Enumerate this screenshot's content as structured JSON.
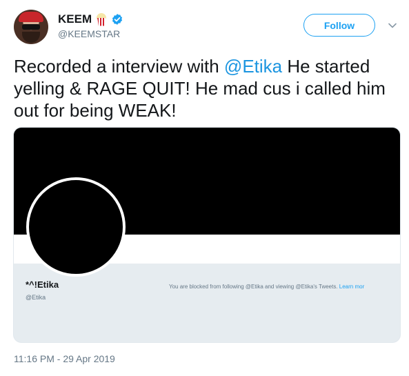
{
  "user": {
    "display_name": "KEEM",
    "handle": "@KEEMSTAR",
    "emoji_icon": "popcorn-icon",
    "verified": true
  },
  "actions": {
    "follow_label": "Follow",
    "menu_icon": "chevron-down-icon"
  },
  "tweet": {
    "text_before": "Recorded a interview with ",
    "mention": "@Etika",
    "text_after": " He started yelling & RAGE QUIT! He mad cus i called him out for being WEAK!",
    "timestamp": "11:16 PM - 29 Apr 2019"
  },
  "card": {
    "profile_name": "*^!Etika",
    "profile_handle": "@Etika",
    "blocked_message": "You are blocked from following @Etika and viewing @Etika's Tweets. ",
    "learn_more": "Learn mor"
  },
  "colors": {
    "accent": "#1da1f2",
    "mention": "#1b95e0",
    "secondary_text": "#657786",
    "card_background": "#e6ecf0"
  }
}
